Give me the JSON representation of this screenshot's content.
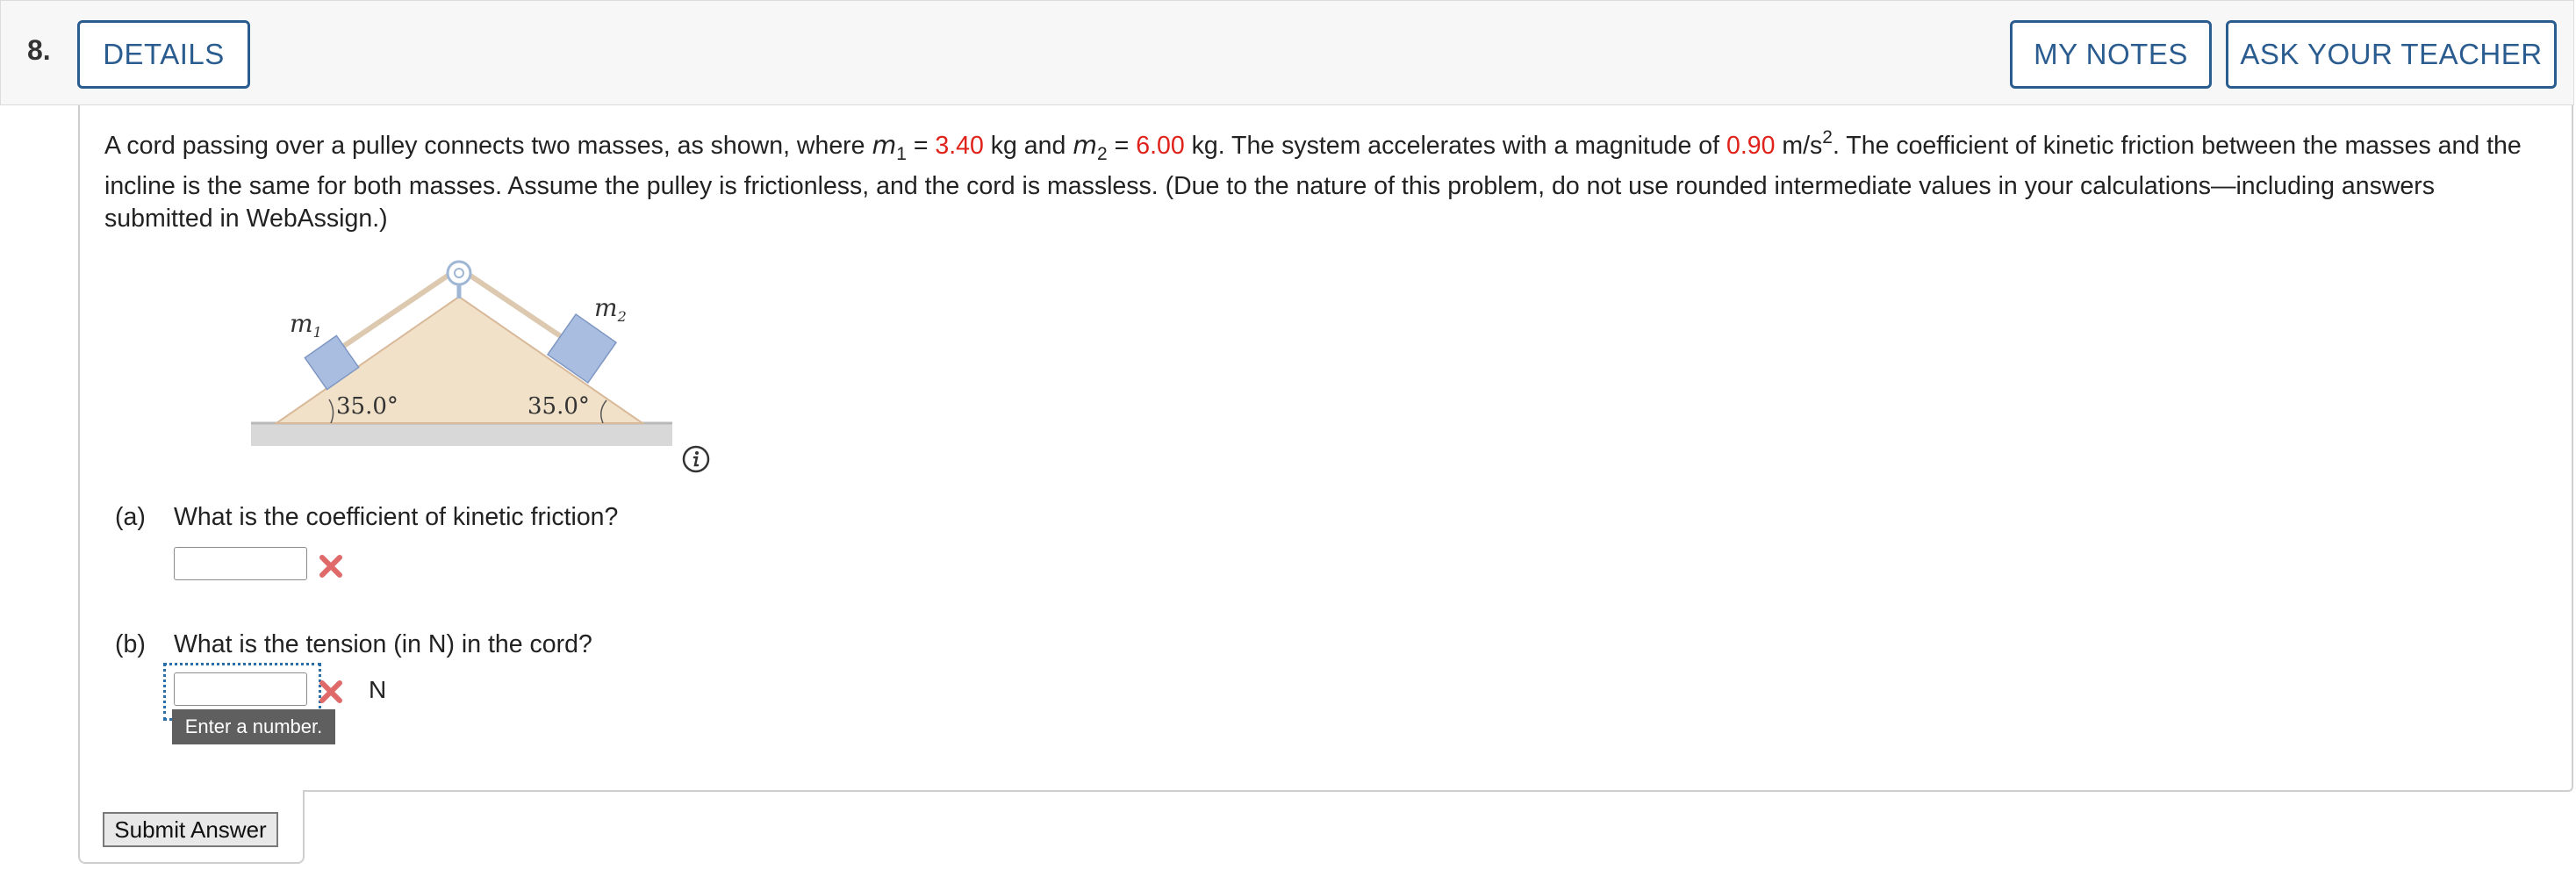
{
  "question": {
    "number": "8.",
    "details_label": "DETAILS",
    "my_notes_label": "MY NOTES",
    "ask_teacher_label": "ASK YOUR TEACHER"
  },
  "problem": {
    "t1": "A cord passing over a pulley connects two masses, as shown, where ",
    "m1_var": "m",
    "m1_sub": "1",
    "eq1": " = ",
    "m1_value": "3.40",
    "t2": " kg and ",
    "m2_var": "m",
    "m2_sub": "2",
    "eq2": " = ",
    "m2_value": "6.00",
    "t3": " kg. The system accelerates with a magnitude of ",
    "accel_value": "0.90",
    "t4": " m/s",
    "exp": "2",
    "t5": ". The coefficient of kinetic friction between the masses and the incline is the same for both masses. Assume the pulley is frictionless, and the cord is massless. (Due to the nature of this problem, do not use rounded intermediate values in your calculations—including answers submitted in WebAssign.)"
  },
  "figure": {
    "m1_label": "m",
    "m1_sub": "1",
    "m2_label": "m",
    "m2_sub": "2",
    "left_angle": "35.0°",
    "right_angle": "35.0°",
    "colors": {
      "incline": "#f0e1c8",
      "block": "#a8bde0",
      "cord": "#dcc9b0",
      "ground": "#c9c9c9"
    }
  },
  "part_a": {
    "letter": "(a)",
    "question": "What is the coefficient of kinetic friction?",
    "value": "",
    "status_icon": "incorrect-x-icon"
  },
  "part_b": {
    "letter": "(b)",
    "question": "What is the tension (in N) in the cord?",
    "value": "",
    "unit": "N",
    "status_icon": "incorrect-x-icon",
    "tooltip": "Enter a number."
  },
  "submit_label": "Submit Answer",
  "colors": {
    "accent": "#2a5c8f",
    "given_value": "#e0231a",
    "incorrect": "#e06a6a"
  }
}
